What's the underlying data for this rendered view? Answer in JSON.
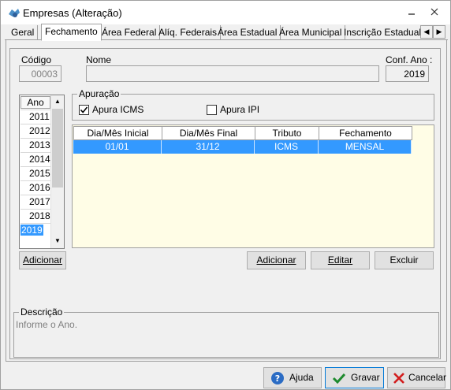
{
  "window": {
    "title": "Empresas (Alteração)"
  },
  "tabs": [
    "Geral",
    "Fechamento",
    "Área Federal",
    "Alíq. Federais",
    "Área Estadual",
    "Área Municipal",
    "Inscrição Estadual S"
  ],
  "header": {
    "codigo_label": "Código",
    "codigo_value": "00003",
    "nome_label": "Nome",
    "nome_value": "",
    "conf_ano_label": "Conf. Ano :",
    "conf_ano_value": "2019"
  },
  "ano_list": {
    "header": "Ano",
    "items": [
      "2011",
      "2012",
      "2013",
      "2014",
      "2015",
      "2016",
      "2017",
      "2018",
      "2019"
    ],
    "selected": "2019",
    "add_label": "Adicionar"
  },
  "apuracao": {
    "title": "Apuração",
    "icms_label": "Apura ICMS",
    "icms_checked": true,
    "ipi_label": "Apura IPI",
    "ipi_checked": false
  },
  "grid": {
    "columns": [
      "Dia/Mês Inicial",
      "Dia/Mês Final",
      "Tributo",
      "Fechamento"
    ],
    "rows": [
      [
        "01/01",
        "31/12",
        "ICMS",
        "MENSAL"
      ]
    ]
  },
  "grid_buttons": {
    "add": "Adicionar",
    "edit": "Editar",
    "delete": "Excluir"
  },
  "descricao": {
    "title": "Descrição",
    "text": "Informe o Ano."
  },
  "footer": {
    "help": "Ajuda",
    "save": "Gravar",
    "cancel": "Cancelar"
  },
  "colors": {
    "selection": "#3399ff",
    "grid_bg": "#fffde6",
    "window_bg": "#f0f0f0"
  }
}
